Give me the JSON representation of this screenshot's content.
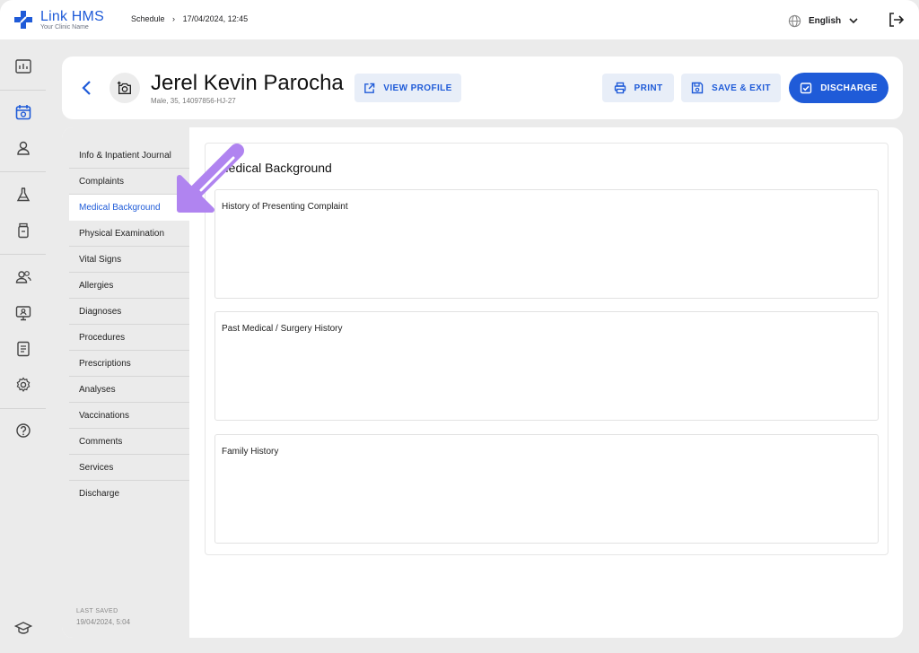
{
  "app": {
    "name": "Link HMS",
    "subtitle": "Your Clinic Name",
    "brand_color": "#1f5bd8"
  },
  "breadcrumb": {
    "section": "Schedule",
    "datetime": "17/04/2024, 12:45"
  },
  "language": {
    "label": "English",
    "icon": "globe-icon"
  },
  "rail": {
    "items": [
      "dashboard-icon",
      "calendar-icon",
      "user-icon",
      "lab-flask-icon",
      "medicine-bottle-icon",
      "staff-group-icon",
      "monitor-user-icon",
      "report-icon",
      "gear-icon",
      "help-icon",
      "graduation-cap-icon"
    ],
    "active": "calendar-icon"
  },
  "patient": {
    "name": "Jerel Kevin Parocha",
    "meta": "Male, 35, 14097856-HJ-27"
  },
  "actions": {
    "view_profile": "VIEW PROFILE",
    "print": "PRINT",
    "save_exit": "SAVE & EXIT",
    "discharge": "DISCHARGE"
  },
  "nav": {
    "items": [
      "Info & Inpatient Journal",
      "Complaints",
      "Medical Background",
      "Physical Examination",
      "Vital Signs",
      "Allergies",
      "Diagnoses",
      "Procedures",
      "Prescriptions",
      "Analyses",
      "Vaccinations",
      "Comments",
      "Services",
      "Discharge"
    ],
    "active": "Medical Background"
  },
  "last_saved": {
    "label": "LAST SAVED",
    "value": "19/04/2024, 5:04"
  },
  "section": {
    "title": "Medical Background",
    "fields": [
      {
        "label": "History of Presenting Complaint",
        "value": ""
      },
      {
        "label": "Past Medical / Surgery History",
        "value": ""
      },
      {
        "label": "Family History",
        "value": ""
      }
    ]
  },
  "annotation": {
    "arrow_color": "#b084f0"
  }
}
